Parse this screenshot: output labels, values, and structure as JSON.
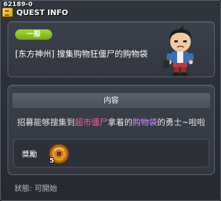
{
  "quest": {
    "id": "62189-0",
    "title_label": "QUEST INFO",
    "category": "一般",
    "name": "[东方神州] 搜集购物狂僵尸的购物袋"
  },
  "content": {
    "header": "内容",
    "desc_part1": "招募能够搜集到",
    "desc_highlight1": "超市僵尸",
    "desc_part2": "拿着的",
    "desc_highlight2": "购物袋",
    "desc_part3": "的勇士~啦啦",
    "reward_label": "獎勵",
    "reward_count": "5"
  },
  "status": {
    "text": "狀態: 可開始"
  },
  "colors": {
    "badge": "#8cc724",
    "highlight_monster": "#ff5fa0",
    "highlight_item": "#d08cff",
    "panel": "#363b44"
  },
  "icons": {
    "title": "quest-icon",
    "reward": "coin-bundle-icon",
    "npc": "npc-portrait"
  }
}
